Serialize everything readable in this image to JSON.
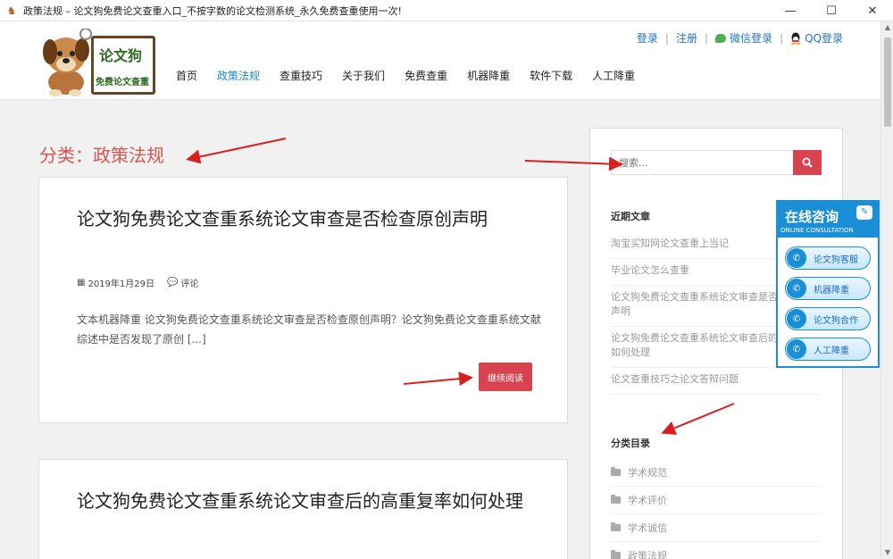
{
  "window": {
    "title": "政策法规 – 论文狗免费论文查重入口_不按字数的论文检测系统_永久免费查重使用一次!",
    "app_icon": "deer-icon",
    "controls": [
      "minimize-icon",
      "maximize-icon",
      "close-icon"
    ]
  },
  "header": {
    "logo": {
      "title": "论文狗",
      "subtitle": "免费论文查重",
      "mascot": "dog-mascot"
    },
    "nav": [
      {
        "label": "首页",
        "active": false
      },
      {
        "label": "政策法规",
        "active": true
      },
      {
        "label": "查重技巧",
        "active": false
      },
      {
        "label": "关于我们",
        "active": false
      },
      {
        "label": "免费查重",
        "active": false
      },
      {
        "label": "机器降重",
        "active": false
      },
      {
        "label": "软件下载",
        "active": false
      },
      {
        "label": "人工降重",
        "active": false
      }
    ],
    "top_links": {
      "login": "登录",
      "register": "注册",
      "wechat_login": "微信登录",
      "qq_login": "QQ登录",
      "separator": "|"
    }
  },
  "main": {
    "category_title": "分类：政策法规",
    "posts": [
      {
        "title": "论文狗免费论文查重系统论文审查是否检查原创声明",
        "date": "2019年1月29日",
        "comments": "评论",
        "excerpt": "文本机器降重 论文狗免费论文查重系统论文审查是否检查原创声明？论文狗免费论文查重系统文献综述中是否发现了原创 [...]",
        "read_more": "继续阅读"
      },
      {
        "title": "论文狗免费论文查重系统论文审查后的高重复率如何处理"
      }
    ]
  },
  "sidebar": {
    "search_placeholder": "搜索...",
    "recent_title": "近期文章",
    "recent_posts": [
      "淘宝买知网论文查重上当记",
      "毕业论文怎么查重",
      "论文狗免费论文查重系统论文审查是否检查原创声明",
      "论文狗免费论文查重系统论文审查后的高重复率如何处理",
      "论文查重技巧之论文答辩问题"
    ],
    "categories_title": "分类目录",
    "categories": [
      "学术规范",
      "学术评价",
      "学术诚信",
      "政策法规"
    ]
  },
  "consult": {
    "title": "在线咨询",
    "subtitle": "ONLINE CONSULTATION",
    "buttons": [
      "论文狗客服",
      "机器降重",
      "论文狗合作",
      "人工降重"
    ]
  },
  "colors": {
    "accent_red": "#d9424f",
    "link_blue": "#1e73be",
    "nav_active": "#1e8bc3",
    "consult_blue": "#1a8fd6"
  }
}
